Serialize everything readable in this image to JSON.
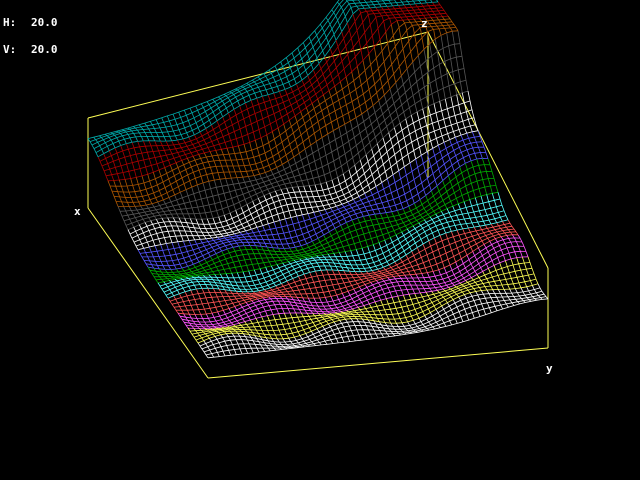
{
  "readout": {
    "h_label": "H:",
    "h_value": "20.0",
    "v_label": "V:",
    "v_value": "20.0"
  },
  "axes": {
    "x_label": "x",
    "y_label": "y",
    "z_label": "z"
  },
  "view": {
    "horizontal_angle": 20.0,
    "vertical_angle": 20.0
  },
  "colors": {
    "background": "#000000",
    "box": "#ffff55",
    "text": "#ffffff",
    "mesh_palette": [
      "#00aaaa",
      "#aa0000",
      "#aa5500",
      "#555555",
      "#ffffff",
      "#5555ff",
      "#00aa00",
      "#55ffff",
      "#ff5555",
      "#ff55ff",
      "#ffff55",
      "#ffffff"
    ]
  }
}
